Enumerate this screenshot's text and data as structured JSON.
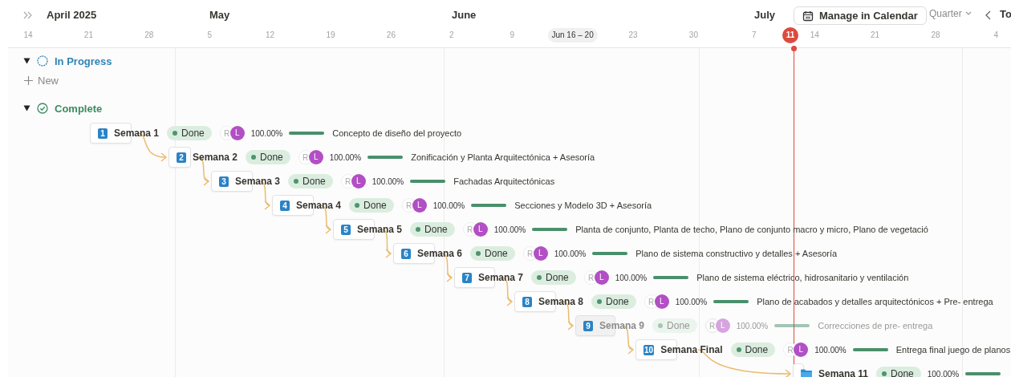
{
  "timeline": {
    "months": [
      "April 2025",
      "May",
      "June",
      "July"
    ],
    "days": [
      {
        "label": "14",
        "selected": false
      },
      {
        "label": "21",
        "selected": false
      },
      {
        "label": "28",
        "selected": false
      },
      {
        "label": "5",
        "selected": false
      },
      {
        "label": "12",
        "selected": false
      },
      {
        "label": "19",
        "selected": false
      },
      {
        "label": "26",
        "selected": false
      },
      {
        "label": "2",
        "selected": false
      },
      {
        "label": "9",
        "selected": false
      },
      {
        "label": "Jun 16 – 20",
        "selected": true
      },
      {
        "label": "23",
        "selected": false
      },
      {
        "label": "30",
        "selected": false
      },
      {
        "label": "7",
        "selected": false
      },
      {
        "label": "14",
        "selected": false
      },
      {
        "label": "21",
        "selected": false
      },
      {
        "label": "28",
        "selected": false
      },
      {
        "label": "4",
        "selected": false
      }
    ],
    "today": "11"
  },
  "toolbar": {
    "calendar_button": "Manage in Calendar",
    "view": "Quarter",
    "partial_button": "To"
  },
  "groups": [
    {
      "label": "In Progress",
      "kind": "in_progress",
      "expanded": true,
      "new_label": "New"
    },
    {
      "label": "Complete",
      "kind": "complete",
      "expanded": true
    }
  ],
  "tasks": [
    {
      "kind": "number",
      "badge": "1",
      "name": "Semana 1",
      "status": "Done",
      "assignees": [
        "R",
        "L"
      ],
      "percent": "100.00%",
      "level": 1,
      "description": "Concepto de diseño del proyecto",
      "dimmed": false
    },
    {
      "kind": "number",
      "badge": "2",
      "name": "Semana 2",
      "status": "Done",
      "assignees": [
        "R",
        "L"
      ],
      "percent": "100.00%",
      "level": 1,
      "description": "Zonificación y Planta Arquitectónica + Asesoría",
      "dimmed": false
    },
    {
      "kind": "number",
      "badge": "3",
      "name": "Semana 3",
      "status": "Done",
      "assignees": [
        "R",
        "L"
      ],
      "percent": "100.00%",
      "level": 1,
      "description": "Fachadas Arquitectónicas",
      "dimmed": false
    },
    {
      "kind": "number",
      "badge": "4",
      "name": "Semana 4",
      "status": "Done",
      "assignees": [
        "R",
        "L"
      ],
      "percent": "100.00%",
      "level": 1,
      "description": "Secciones y Modelo 3D + Asesoría",
      "dimmed": false
    },
    {
      "kind": "number",
      "badge": "5",
      "name": "Semana 5",
      "status": "Done",
      "assignees": [
        "R",
        "L"
      ],
      "percent": "100.00%",
      "level": 1,
      "description": "Planta de conjunto, Planta de techo, Plano de conjunto macro y micro, Plano de vegetació",
      "dimmed": false
    },
    {
      "kind": "number",
      "badge": "6",
      "name": "Semana 6",
      "status": "Done",
      "assignees": [
        "R",
        "L"
      ],
      "percent": "100.00%",
      "level": 1,
      "description": "Plano de sistema constructivo y detalles + Asesoría",
      "dimmed": false
    },
    {
      "kind": "number",
      "badge": "7",
      "name": "Semana 7",
      "status": "Done",
      "assignees": [
        "R",
        "L"
      ],
      "percent": "100.00%",
      "level": 1,
      "description": "Plano de sistema eléctrico, hidrosanitario y ventilación",
      "dimmed": false
    },
    {
      "kind": "number",
      "badge": "8",
      "name": "Semana 8",
      "status": "Done",
      "assignees": [
        "R",
        "L"
      ],
      "percent": "100.00%",
      "level": 1,
      "description": "Plano de acabados y detalles arquitectónicos + Pre- entrega",
      "dimmed": false
    },
    {
      "kind": "number",
      "badge": "9",
      "name": "Semana 9",
      "status": "Done",
      "assignees": [
        "R",
        "L"
      ],
      "percent": "100.00%",
      "level": 1,
      "description": "Correcciones de pre- entrega",
      "dimmed": true
    },
    {
      "kind": "number",
      "badge": "10",
      "name": "Semana Final",
      "status": "Done",
      "assignees": [
        "R",
        "L"
      ],
      "percent": "100.00%",
      "level": 1,
      "description": "Entrega final juego de planos",
      "dimmed": false
    },
    {
      "kind": "folder",
      "name": "Semana 11",
      "status": "Done",
      "percent": "100.00%",
      "level": 1,
      "dimmed": false
    }
  ]
}
